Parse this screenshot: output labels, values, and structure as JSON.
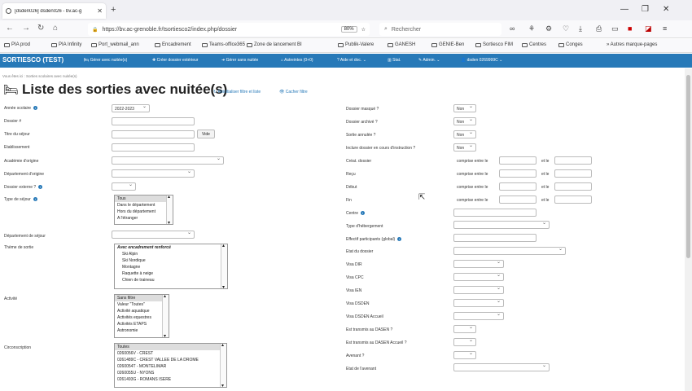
{
  "browser": {
    "tab_title": "[dsden026] dsden026 - bv.ac-g",
    "url": "https://bv.ac-grenoble.fr/tsortiesco2/index.php/dossier",
    "zoom": "80%",
    "search_placeholder": "Rechercher"
  },
  "bookmarks": [
    "PIA prod",
    "PIA Infinity",
    "Port_webmail_ann",
    "Encadrement",
    "Teams-office365",
    "Zone de lancement BI",
    "Publik-Valere",
    "GANESH",
    "GENIE-Ben",
    "Sortiesco FIM",
    "Centres",
    "Conges"
  ],
  "bookmarks_other": "Autres marque-pages",
  "app": {
    "brand": "SORTIESCO (TEST)",
    "menu": [
      "Gérer avec nuitée(s)",
      "Créer dossier extérieur",
      "Gérer sans nuitée",
      "Astreintes (0+0)",
      "Aide et doc.",
      "Stat.",
      "Admin.",
      "dsden 0269999C"
    ]
  },
  "breadcrumb": "Vous êtes ici : Sorties scolaires avec nuitée(s)",
  "page_title": "Liste des sorties avec nuitée(s)",
  "reset_link": "Réinitialiser filtre et liste",
  "hide_link": "Cacher filtre",
  "left": {
    "annee_label": "Année scolaire",
    "annee_value": "2022-2023",
    "dossier_label": "Dossier #",
    "titre_label": "Titre du séjour",
    "vide_btn": "Vide",
    "etab_label": "Etablissement",
    "academie_label": "Académie d'origine",
    "dept_origine_label": "Département d'origine",
    "dossier_externe_label": "Dossier externe ?",
    "type_label": "Type de séjour",
    "type_options": [
      "Tous",
      "Dans le département",
      "Hors du département",
      "A l'étranger"
    ],
    "dept_sejour_label": "Département de séjour",
    "theme_label": "Thème de sortie",
    "theme_options": [
      "",
      "Avec encadrement renforcé",
      "Ski Alpin",
      "Ski Nordique",
      "Montagne",
      "Raquette à neige",
      "Chien de traineau"
    ],
    "activite_label": "Activité",
    "activite_options": [
      "Sans filtre",
      "Valeur \"Toutes\"",
      "Activité aquatique",
      "Activités equestres",
      "Activités ETAPS",
      "Astronomie"
    ],
    "circ_label": "Circonscription",
    "circ_options": [
      "Toutes",
      "0260056V - CREST",
      "0261489C - CREST VALLEE DE LA DROME",
      "0260054T - MONTELIMAR",
      "0260055U - NYONS",
      "0261493G - ROMANS ISERE"
    ]
  },
  "right": {
    "masque_label": "Dossier masqué ?",
    "masque_value": "Non",
    "archive_label": "Dossier archivé ?",
    "archive_value": "Non",
    "annulee_label": "Sortie annulée ?",
    "annulee_value": "Non",
    "instruction_label": "Inclure dossier en cours d'instruction ?",
    "instruction_value": "Non",
    "creat_label": "Créat. dossier",
    "recu_label": "Reçu",
    "debut_label": "Début",
    "fin_label": "Fin",
    "comprise": "comprise entre le",
    "et_le": "et le",
    "centre_label": "Centre",
    "hebergement_label": "Type d'hébergement",
    "effectif_label": "Effectif participants (global)",
    "etat_label": "Etat du dossier",
    "visa_dir_label": "Visa DIR",
    "visa_cpc_label": "Visa CPC",
    "visa_ien_label": "Visa IEN",
    "visa_dsden_label": "Visa DSDEN",
    "visa_dsden_acc_label": "Visa DSDEN Accueil",
    "transmis_label": "Est transmis au DASEN ?",
    "transmis_acc_label": "Est transmis au DASEN Accueil ?",
    "avenant_label": "Avenant ?",
    "etat_avenant_label": "Etat de l'avenant"
  }
}
